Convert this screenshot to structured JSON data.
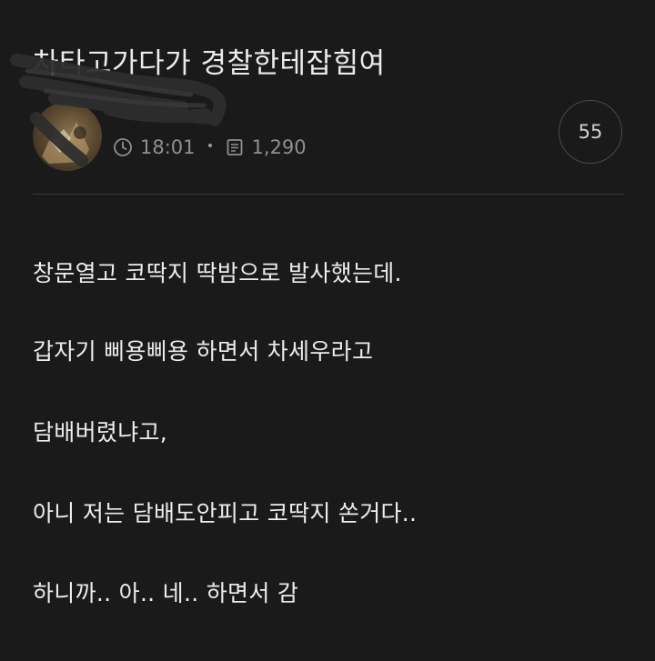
{
  "post": {
    "title": "차타고가다가 경찰한테잡힘여",
    "author_name": "",
    "time": "18:01",
    "views": "1,290",
    "comment_count": "55",
    "body_lines": [
      "창문열고 코딱지 딱밤으로 발사했는데.",
      "갑자기 삐용삐용 하면서 차세우라고",
      "담배버렸냐고,",
      "아니 저는 담배도안피고 코딱지 쏜거다..",
      "하니까.. 아.. 네.. 하면서 감"
    ]
  },
  "icons": {
    "time": "clock-icon",
    "views": "document-icon"
  },
  "colors": {
    "background": "#1a1a1a",
    "text": "#ededed",
    "meta": "#8f8f8f",
    "divider": "#3a3a3a"
  }
}
